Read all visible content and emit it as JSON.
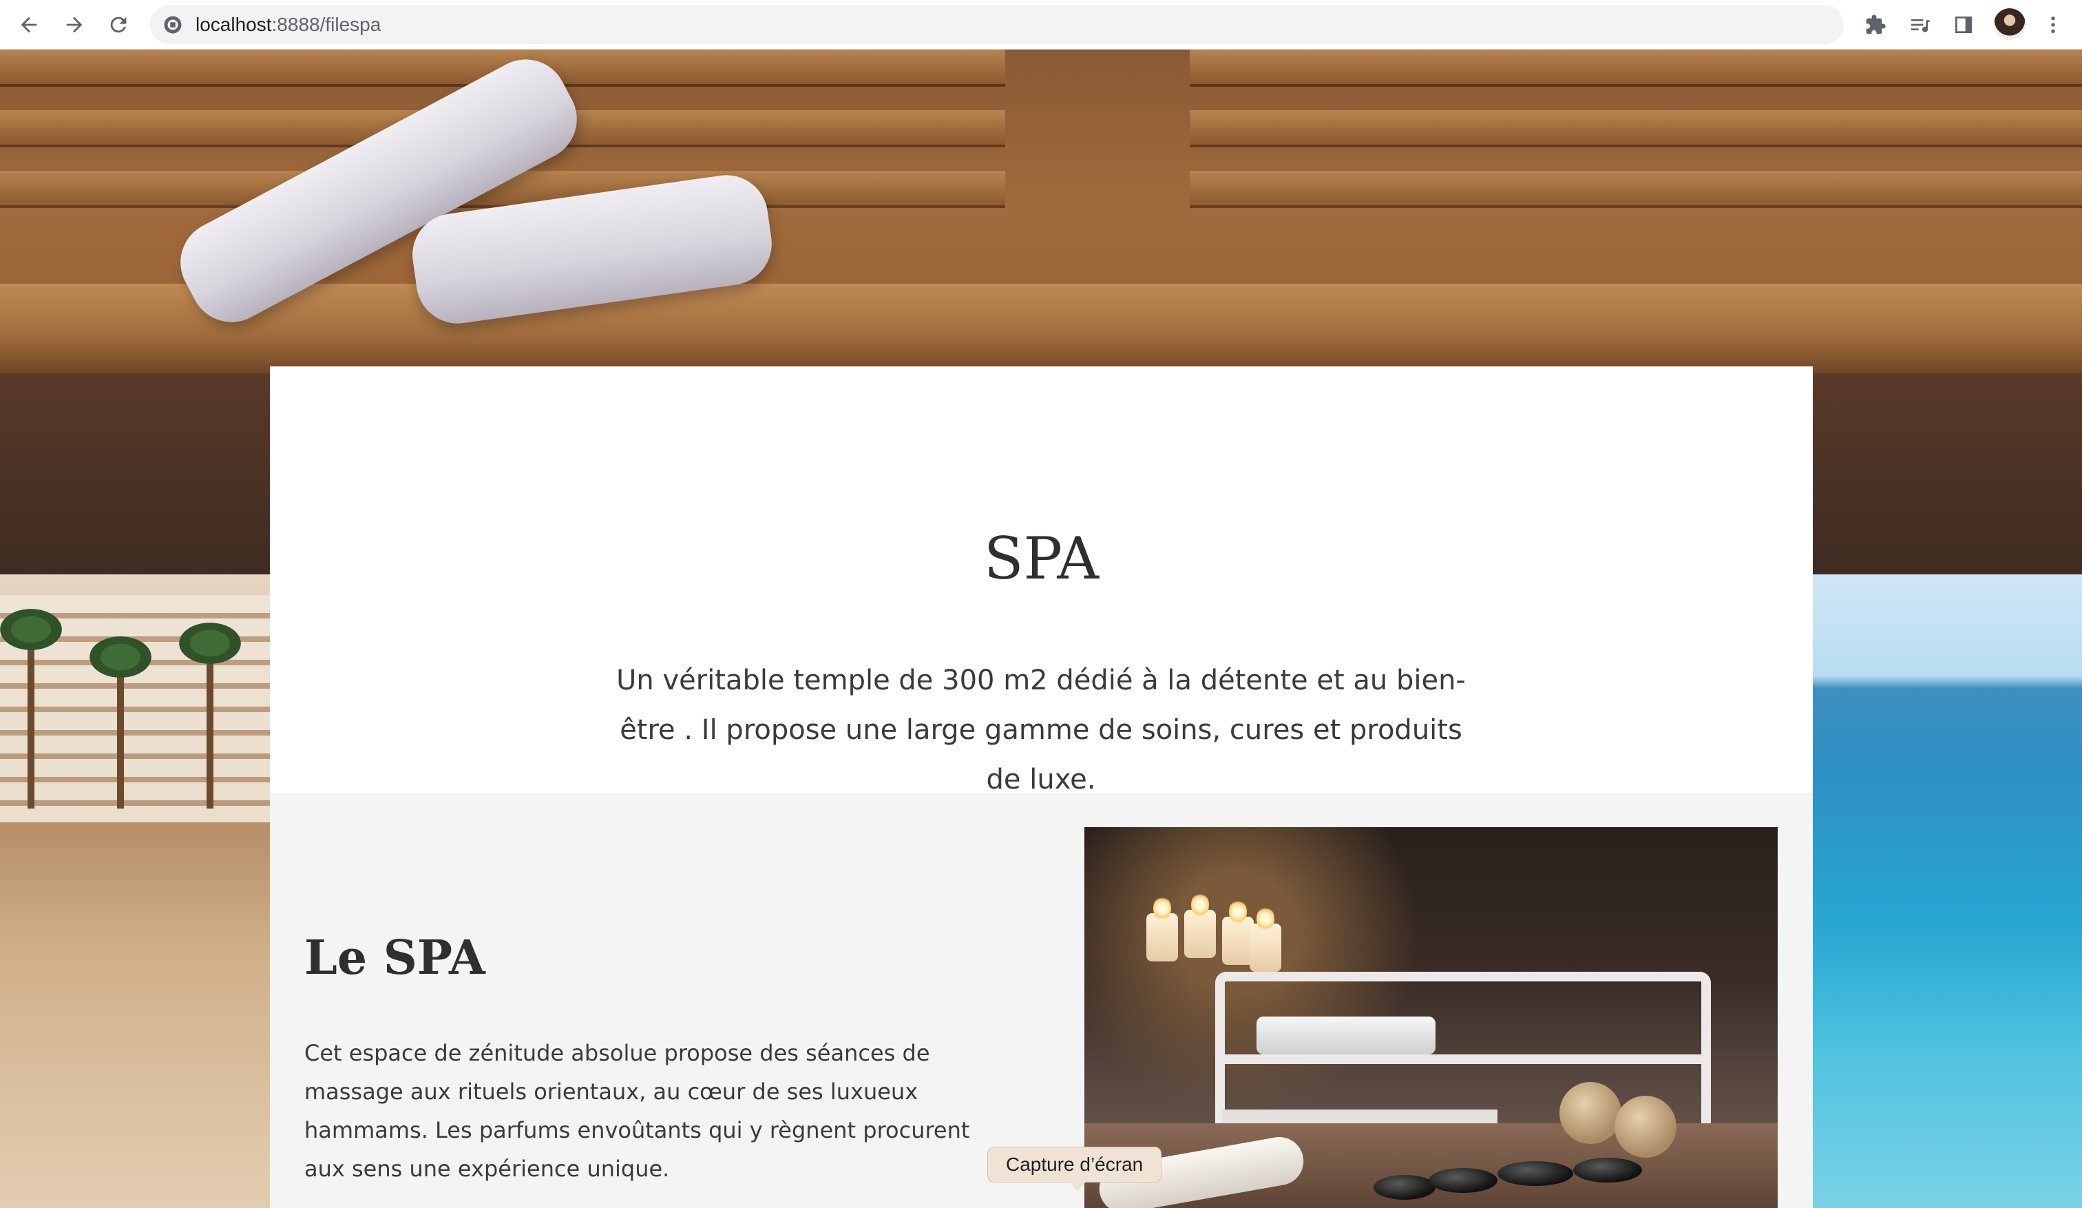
{
  "browser": {
    "url_host": "localhost",
    "url_path": ":8888/filespa"
  },
  "page": {
    "title": "SPA",
    "intro": "Un véritable temple de 300 m2 dédié à la détente et au bien-être . Il propose une large gamme de soins, cures et produits de luxe.",
    "section": {
      "title": "Le SPA",
      "text": "Cet espace de zénitude absolue propose des séances de massage aux rituels orientaux, au cœur de ses luxueux hammams. Les parfums envoûtants qui y règnent procurent aux sens une expérience unique."
    }
  },
  "tooltip": {
    "label": "Capture d’écran"
  },
  "icons": {
    "back": "arrow-left-icon",
    "forward": "arrow-right-icon",
    "reload": "reload-icon",
    "site": "site-info-icon",
    "extensions": "puzzle-icon",
    "reading_list": "reading-list-icon",
    "side_panel": "side-panel-icon",
    "menu": "kebab-menu-icon"
  }
}
